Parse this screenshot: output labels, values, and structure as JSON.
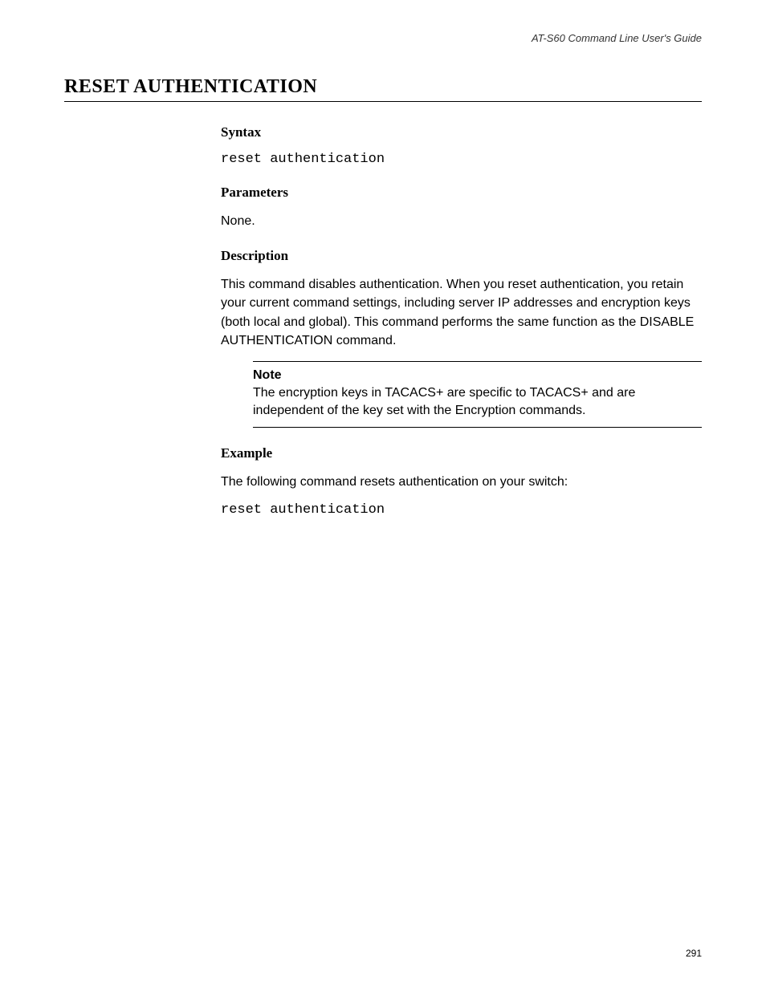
{
  "header": {
    "guide_title": "AT-S60 Command Line User's Guide"
  },
  "title": "RESET AUTHENTICATION",
  "syntax": {
    "heading": "Syntax",
    "code": "reset authentication"
  },
  "parameters": {
    "heading": "Parameters",
    "text": "None."
  },
  "description": {
    "heading": "Description",
    "text": "This command disables authentication. When you reset authentication, you retain your current command settings, including server IP addresses and encryption keys (both local and global). This command performs the same function as the DISABLE AUTHENTICATION command."
  },
  "note": {
    "title": "Note",
    "body": "The encryption keys in TACACS+ are specific to TACACS+ and are independent of the key set with the Encryption commands."
  },
  "example": {
    "heading": "Example",
    "text": "The following command resets authentication on your switch:",
    "code": "reset authentication"
  },
  "page_number": "291"
}
